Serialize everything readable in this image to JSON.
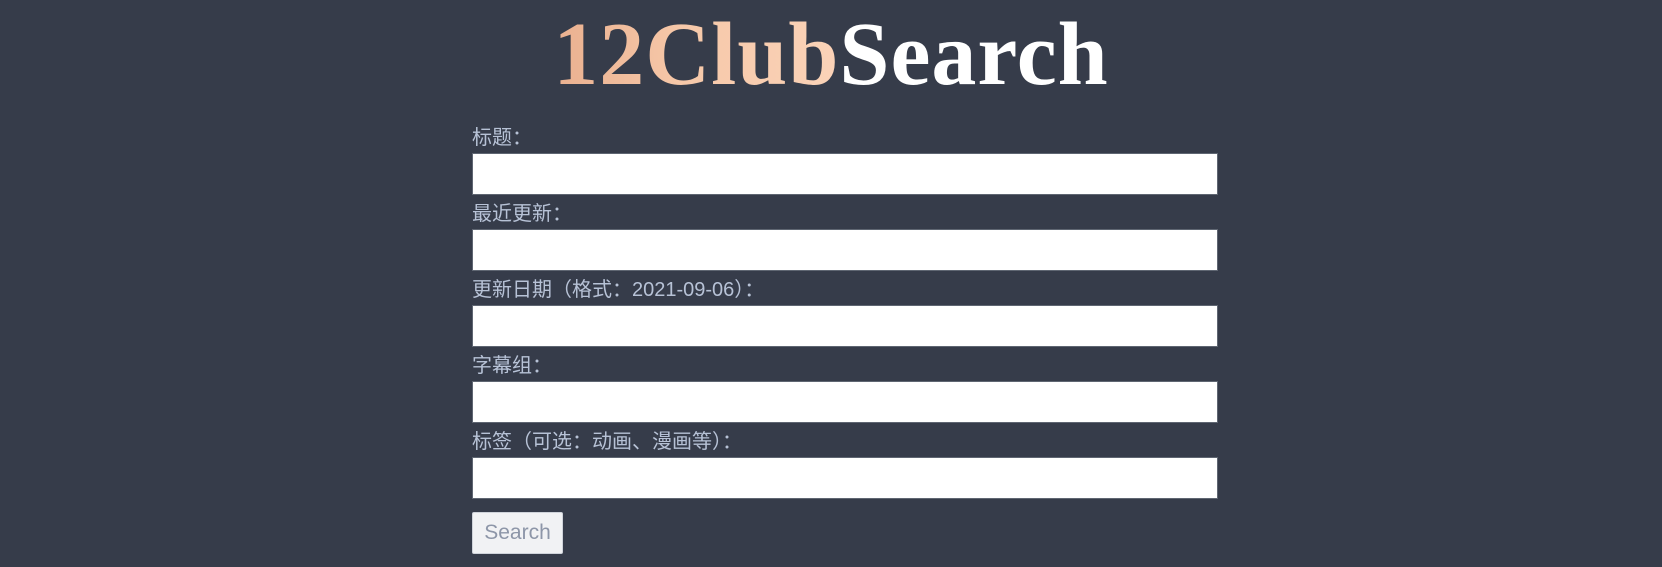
{
  "logo": {
    "part1": "12Club",
    "part2": "Search"
  },
  "form": {
    "fields": [
      {
        "label": "标题：",
        "value": ""
      },
      {
        "label": "最近更新：",
        "value": ""
      },
      {
        "label": "更新日期（格式：2021-09-06）：",
        "value": ""
      },
      {
        "label": "字幕组：",
        "value": ""
      },
      {
        "label": "标签（可选：动画、漫画等）：",
        "value": ""
      }
    ],
    "search_label": "Search"
  },
  "colors": {
    "background": "#363c4a",
    "label": "#b7c2d6",
    "logo_accent": "#f6c8a9",
    "logo_white": "#ffffff"
  }
}
